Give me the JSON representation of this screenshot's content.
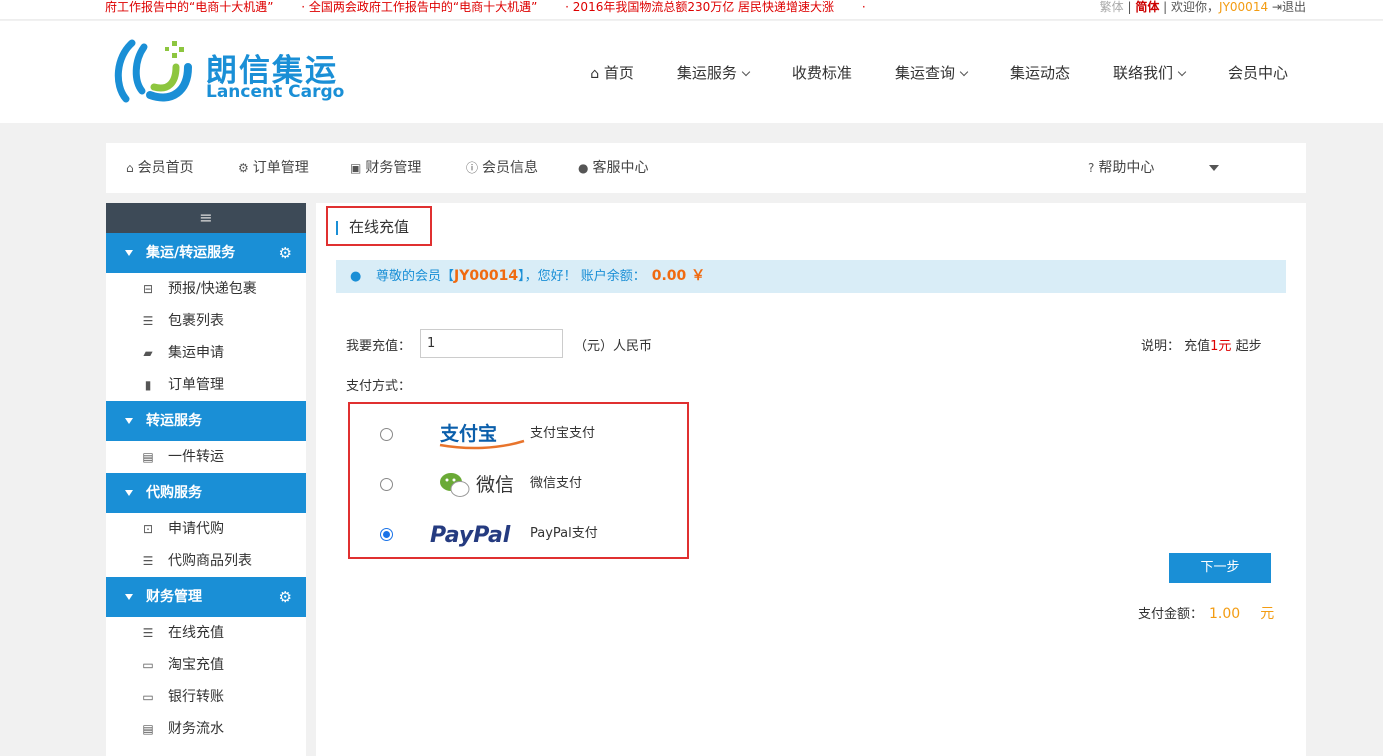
{
  "topbar": {
    "news": [
      "府工作报告中的“电商十大机遇”",
      "· 全国两会政府工作报告中的“电商十大机遇”",
      "· 2016年我国物流总额230万亿 居民快递增速大涨",
      "·"
    ],
    "lang_traditional": "繁体",
    "sep": "|",
    "lang_simplified": "简体",
    "welcome": "欢迎你，",
    "user_id": "JY00014",
    "logout": "退出"
  },
  "logo": {
    "cn": "朗信集运",
    "en": "Lancent Cargo"
  },
  "mainnav": [
    {
      "label": "首页",
      "icon": "home-icon"
    },
    {
      "label": "集运服务",
      "dropdown": true
    },
    {
      "label": "收费标准"
    },
    {
      "label": "集运查询",
      "dropdown": true
    },
    {
      "label": "集运动态"
    },
    {
      "label": "联络我们",
      "dropdown": true
    },
    {
      "label": "会员中心"
    }
  ],
  "membernav": {
    "home": "会员首页",
    "orders": "订单管理",
    "finance": "财务管理",
    "info": "会员信息",
    "service": "客服中心",
    "help": "帮助中心"
  },
  "sidebar": {
    "menu_icon": "≡",
    "sections": [
      {
        "title": "集运/转运服务",
        "has_gear": true,
        "items": [
          {
            "label": "预报/快递包裹",
            "icon": "package-icon"
          },
          {
            "label": "包裹列表",
            "icon": "list-icon"
          },
          {
            "label": "集运申请",
            "icon": "truck-icon"
          },
          {
            "label": "订单管理",
            "icon": "book-icon"
          }
        ]
      },
      {
        "title": "转运服务",
        "has_gear": false,
        "items": [
          {
            "label": "一件转运",
            "icon": "chart-icon"
          }
        ]
      },
      {
        "title": "代购服务",
        "has_gear": false,
        "items": [
          {
            "label": "申请代购",
            "icon": "inbox-icon"
          },
          {
            "label": "代购商品列表",
            "icon": "list-icon"
          }
        ]
      },
      {
        "title": "财务管理",
        "has_gear": true,
        "items": [
          {
            "label": "在线充值",
            "icon": "list-icon"
          },
          {
            "label": "淘宝充值",
            "icon": "card-icon"
          },
          {
            "label": "银行转账",
            "icon": "card-icon"
          },
          {
            "label": "财务流水",
            "icon": "chart-icon"
          }
        ]
      }
    ]
  },
  "content": {
    "title": "在线充值",
    "notice_prefix": "尊敬的会员【",
    "notice_id": "JY00014",
    "notice_mid": "】，您好！ 账户余额：",
    "notice_balance": "0.00 ￥",
    "recharge_label": "我要充值：",
    "recharge_value": "1",
    "recharge_unit": "（元）人民币",
    "note_prefix": "说明：  充值",
    "note_amount": "1元",
    "note_suffix": "起步",
    "pay_method_label": "支付方式：",
    "payments": [
      {
        "name": "支付宝支付",
        "logo_text": "支付宝",
        "selected": false
      },
      {
        "name": "微信支付",
        "logo_text": "微信",
        "selected": false
      },
      {
        "name": "PayPal支付",
        "logo_text": "PayPal",
        "selected": true
      }
    ],
    "next_button": "下一步",
    "pay_amount_label": "支付金额：",
    "pay_amount_value": "1.00",
    "pay_amount_unit": "元"
  },
  "colors": {
    "brand": "#1a8fd6",
    "accent_orange": "#f06a10",
    "highlight_red": "#e03030"
  }
}
